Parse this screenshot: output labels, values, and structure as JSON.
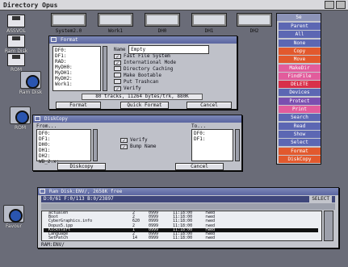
{
  "app_title": "Directory Opus",
  "desktop_icons": [
    {
      "label": "ASSVOL"
    },
    {
      "label": "Ram Disk"
    },
    {
      "label": "ROM"
    },
    {
      "label": "Ram Disk"
    },
    {
      "label": "ROM"
    },
    {
      "label": "Favour"
    }
  ],
  "drives": [
    "System2.0",
    "Work1",
    "DH0",
    "DH1",
    "DH2"
  ],
  "format_window": {
    "title": "Format",
    "devices": [
      "DF0:",
      "DF1:",
      "RAD:",
      "MyDH0:",
      "MyDH1:",
      "MyDH2:",
      "Work1:"
    ],
    "name_label": "Name",
    "name_value": "Empty",
    "options": [
      {
        "label": "Fast File System",
        "checked": true
      },
      {
        "label": "International Mode",
        "checked": true
      },
      {
        "label": "Directory Caching",
        "checked": false
      },
      {
        "label": "Make Bootable",
        "checked": false
      },
      {
        "label": "Put Trashcan",
        "checked": false
      },
      {
        "label": "Verify",
        "checked": true
      }
    ],
    "status": "80 tracks, 11264 bytes/trk, 880K",
    "buttons": [
      "Format",
      "Quick Format",
      "Cancel"
    ]
  },
  "diskcopy_window": {
    "title": "DiskCopy",
    "from_label": "From...",
    "to_label": "To...",
    "from_list": [
      "DF0:",
      "DF1:",
      "DH0:",
      "DH1:",
      "DH2:",
      "WB_2.x:"
    ],
    "to_list": [
      "DF0:",
      "DF1:"
    ],
    "options": [
      {
        "label": "Verify",
        "checked": true
      },
      {
        "label": "Bump Name",
        "checked": true
      }
    ],
    "buttons": [
      "Diskcopy",
      "Cancel"
    ]
  },
  "right_panel": {
    "header": "Se",
    "buttons": [
      {
        "label": "Parent",
        "color": "#5c67b3"
      },
      {
        "label": "All",
        "color": "#5c67b3"
      },
      {
        "label": "None",
        "color": "#5c67b3"
      },
      {
        "label": "Copy",
        "color": "#e2592d"
      },
      {
        "label": "Move",
        "color": "#e2592d"
      },
      {
        "label": "MakeDir",
        "color": "#e25c9c"
      },
      {
        "label": "FindFile",
        "color": "#e25c9c"
      },
      {
        "label": "DELETE",
        "color": "#d8304a"
      },
      {
        "label": "Devices",
        "color": "#5c67b3"
      },
      {
        "label": "Protect",
        "color": "#7b4fb0"
      },
      {
        "label": "Print",
        "color": "#e25c9c"
      },
      {
        "label": "Search",
        "color": "#5c67b3"
      },
      {
        "label": "Read",
        "color": "#5c67b3"
      },
      {
        "label": "Show",
        "color": "#5c67b3"
      },
      {
        "label": "Select",
        "color": "#5c67b3"
      },
      {
        "label": "Format",
        "color": "#e2592d"
      },
      {
        "label": "DiskCopy",
        "color": "#e2592d"
      }
    ]
  },
  "lister": {
    "title": "Ram Disk:ENV/, 2658K free",
    "info": "D:0/61 F:0/113 B:0/23897",
    "select_label": "SELECT",
    "rows": [
      {
        "name": "actualen",
        "size": "2",
        "prot": "0999",
        "date": "11:18:00",
        "flags": "rwed"
      },
      {
        "name": "Boot",
        "size": "2",
        "prot": "0999",
        "date": "11:18:00",
        "flags": "rwed"
      },
      {
        "name": "CyberGraphics.info",
        "size": "620",
        "prot": "0999",
        "date": "11:18:00",
        "flags": "rwed"
      },
      {
        "name": "Dopus5.ipp",
        "size": "2",
        "prot": "0999",
        "date": "11:18:00",
        "flags": "rwed"
      },
      {
        "name": "Kickstart",
        "size": "1",
        "prot": "0999",
        "date": "11:18:00",
        "flags": "rwed"
      },
      {
        "name": "Language",
        "size": "2",
        "prot": "0999",
        "date": "11:18:00",
        "flags": "rwed"
      },
      {
        "name": "SetPatch",
        "size": "14",
        "prot": "0999",
        "date": "11:18:00",
        "flags": "rwed"
      }
    ],
    "path": "RAM:ENV/"
  }
}
